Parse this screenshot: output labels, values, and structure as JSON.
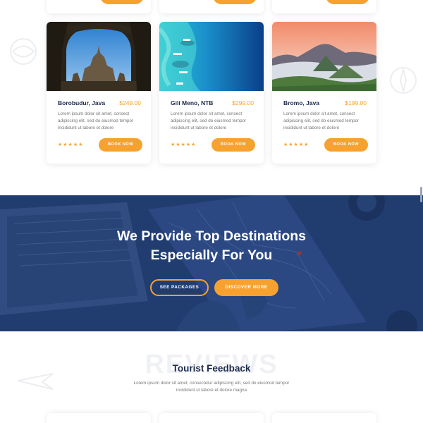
{
  "colors": {
    "accent": "#f7a22f",
    "navy": "#1c2a4d",
    "hero_overlay": "#1d3a73"
  },
  "destinations": [
    {
      "name": "Borobudur, Java",
      "price": "$249.00",
      "description": "Lorem ipsum dolor sit amet, consect adipiscing elit, sed do eiusmod tempor incididunt ut labore et dolore",
      "stars": "★★★★★",
      "book_label": "BOOK NOW",
      "image": "temple-photo"
    },
    {
      "name": "Gili Meno, NTB",
      "price": "$299.00",
      "description": "Lorem ipsum dolor sit amet, consect adipiscing elit, sed do eiusmod tempor incididunt ut labore et dolore",
      "stars": "★★★★★",
      "book_label": "BOOK NOW",
      "image": "reef-photo"
    },
    {
      "name": "Bromo, Java",
      "price": "$199.00",
      "description": "Lorem ipsum dolor sit amet, consect adipiscing elit, sed do eiusmod tempor incididunt ut labore et dolore",
      "stars": "★★★★★",
      "book_label": "BOOK NOW",
      "image": "volcano-photo"
    }
  ],
  "hero": {
    "headline_line1": "We Provide Top Destinations",
    "headline_line2": "Especially For You",
    "see_packages_label": "SEE PACKAGES",
    "discover_more_label": "DISCOVER MORE"
  },
  "reviews": {
    "watermark": "REVIEWS",
    "title": "Tourist Feedback",
    "description": "Lorem ipsum dolor sit amet, consectetur adipiscing elit, sed do eiusmod tempor incididunt ut labore et dolore magna"
  }
}
